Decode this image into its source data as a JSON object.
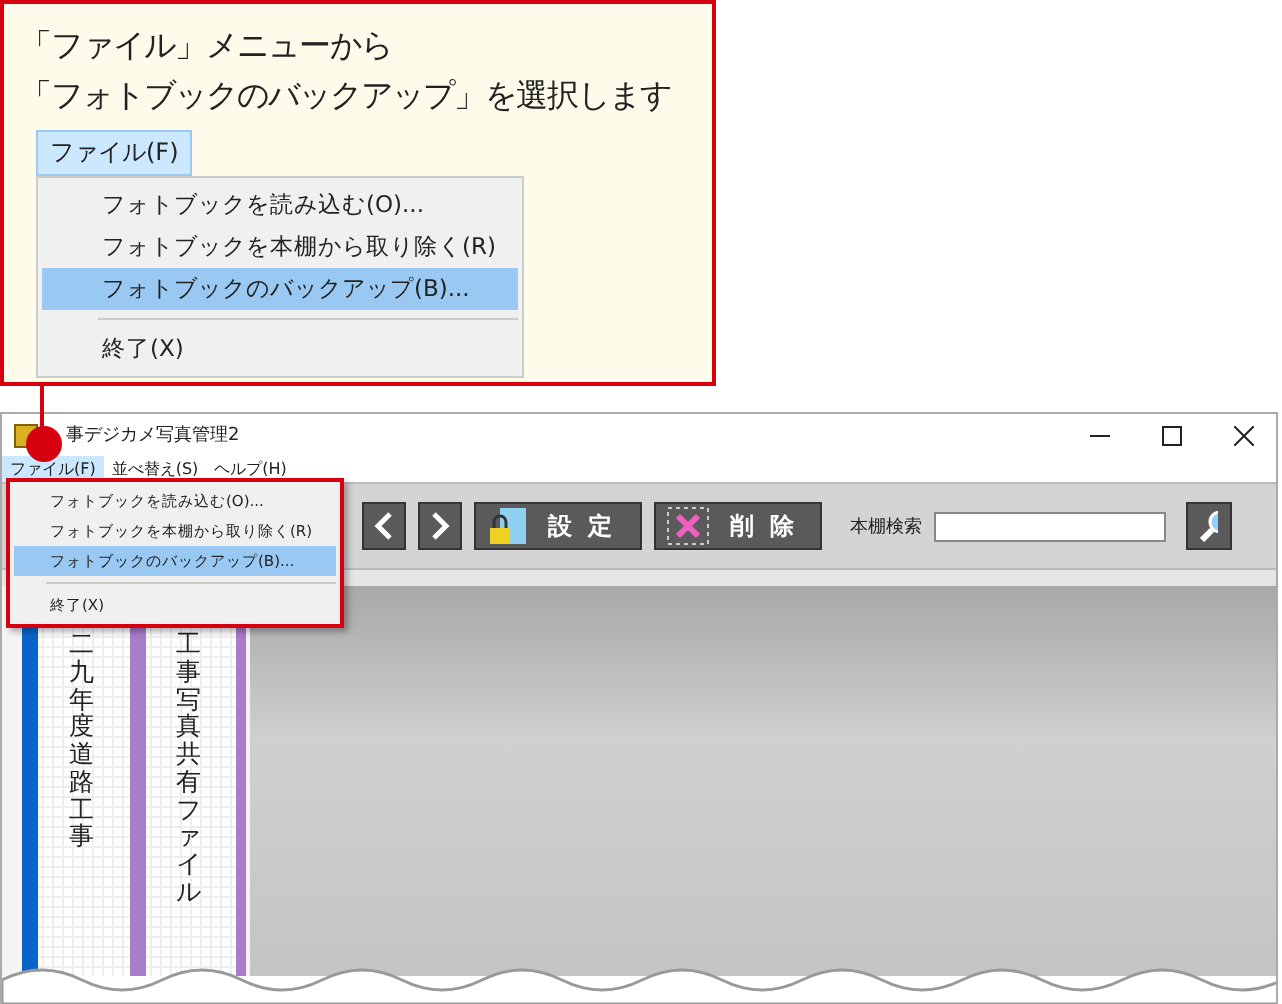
{
  "callout": {
    "lines": [
      "「ファイル」メニューから",
      "「フォトブックのバックアップ」を選択します"
    ],
    "menu_title": "ファイル(F)",
    "menu_items": [
      {
        "kind": "item",
        "label": "フォトブックを読み込む(O)...",
        "selected": false
      },
      {
        "kind": "item",
        "label": "フォトブックを本棚から取り除く(R)",
        "selected": false
      },
      {
        "kind": "item",
        "label": "フォトブックのバックアップ(B)...",
        "selected": true
      },
      {
        "kind": "separator"
      },
      {
        "kind": "item",
        "label": "終了(X)",
        "selected": false
      }
    ]
  },
  "window": {
    "title": "事デジカメ写真管理2",
    "menus": [
      {
        "label": "ファイル(F)",
        "selected": true
      },
      {
        "label": "並べ替え(S)",
        "selected": false
      },
      {
        "label": "ヘルプ(H)",
        "selected": false
      }
    ],
    "dropdown": [
      {
        "kind": "item",
        "label": "フォトブックを読み込む(O)...",
        "selected": false
      },
      {
        "kind": "item",
        "label": "フォトブックを本棚から取り除く(R)",
        "selected": false
      },
      {
        "kind": "item",
        "label": "フォトブックのバックアップ(B)...",
        "selected": true
      },
      {
        "kind": "separator"
      },
      {
        "kind": "item",
        "label": "終了(X)",
        "selected": false
      }
    ],
    "toolbar": {
      "settings": "設定",
      "delete": "削除",
      "search_label": "本棚検索"
    },
    "books": [
      {
        "title": "二九年度道路工事",
        "color": "#0a64c8"
      },
      {
        "title": "工事写真共有ファイル",
        "color": "#a87cc8"
      }
    ]
  }
}
